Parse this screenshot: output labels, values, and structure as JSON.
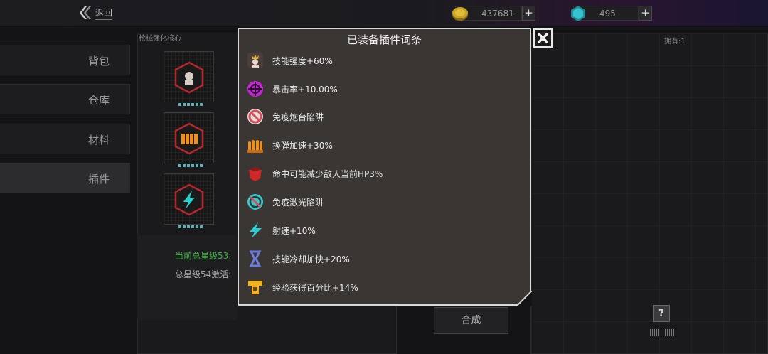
{
  "topbar": {
    "back_label": "返回",
    "gold": {
      "value": "437681",
      "add": "+"
    },
    "gems": {
      "value": "495",
      "add": "+"
    }
  },
  "sidebar": {
    "items": [
      {
        "label": "背包"
      },
      {
        "label": "仓库"
      },
      {
        "label": "材料"
      },
      {
        "label": "插件"
      }
    ],
    "active_index": 3
  },
  "middle": {
    "title": "枪械强化核心",
    "current_star": "当前总星级53:",
    "star54": "总星级54激活:"
  },
  "right": {
    "owned": "拥有:1",
    "compose": "合成",
    "help": "?"
  },
  "modal": {
    "title": "已装备插件词条",
    "close_icon": "close-icon",
    "entries": [
      {
        "label": "技能强度+60%",
        "icon": "skill-power-icon",
        "color": "#e8d6cf"
      },
      {
        "label": "暴击率+10.00%",
        "icon": "crit-rate-icon",
        "color": "#c626d6"
      },
      {
        "label": "免疫炮台陷阱",
        "icon": "turret-immune-icon",
        "color": "#d05060"
      },
      {
        "label": "换弹加速+30%",
        "icon": "reload-icon",
        "color": "#f0901c"
      },
      {
        "label": "命中可能减少敌人当前HP3%",
        "icon": "hp-reduce-icon",
        "color": "#d02828"
      },
      {
        "label": "免疫激光陷阱",
        "icon": "laser-immune-icon",
        "color": "#3ec8c8"
      },
      {
        "label": "射速+10%",
        "icon": "fire-rate-icon",
        "color": "#2ad0d0"
      },
      {
        "label": "技能冷却加快+20%",
        "icon": "cooldown-icon",
        "color": "#6d7ddf"
      },
      {
        "label": "经验获得百分比+14%",
        "icon": "exp-icon",
        "color": "#f3b21e"
      }
    ]
  },
  "colors": {
    "gold_coin": "#c9a322",
    "gem": "#2fb6c4",
    "star_green": "#3fae3f"
  }
}
